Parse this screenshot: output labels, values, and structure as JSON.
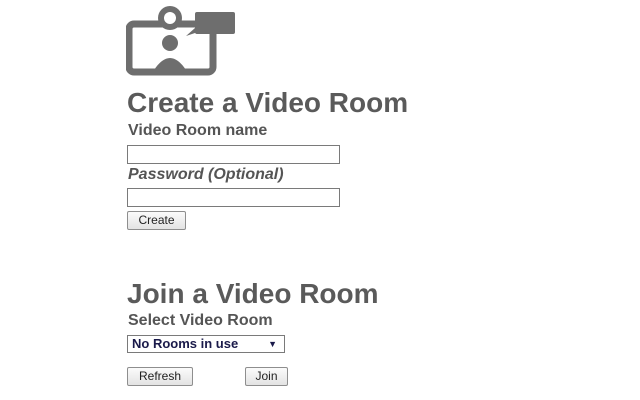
{
  "create": {
    "heading": "Create a Video Room",
    "name_label": "Video Room name",
    "name_value": "",
    "password_label": "Password (Optional)",
    "password_value": "",
    "create_button": "Create"
  },
  "join": {
    "heading": "Join a Video Room",
    "select_label": "Select Video Room",
    "selected_room": "No Rooms in use",
    "refresh_button": "Refresh",
    "join_button": "Join"
  },
  "icons": {
    "logo": "video-room-logo-icon",
    "dropdown": "dropdown-arrow-icon"
  },
  "colors": {
    "heading": "#5a5a5a",
    "logo": "#6e6e6e",
    "select_text": "#1a1a4a"
  }
}
